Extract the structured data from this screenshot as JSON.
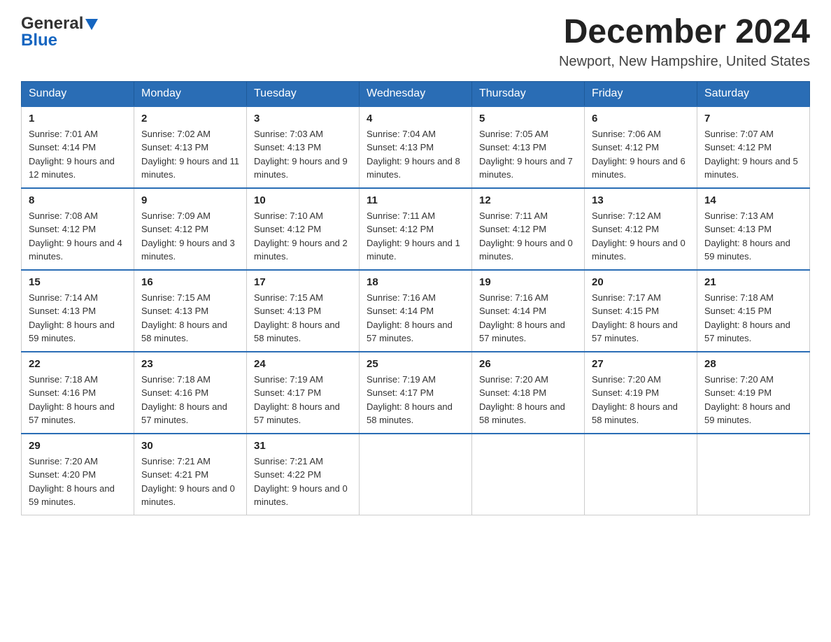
{
  "header": {
    "logo_general": "General",
    "logo_blue": "Blue",
    "month_title": "December 2024",
    "location": "Newport, New Hampshire, United States"
  },
  "weekdays": [
    "Sunday",
    "Monday",
    "Tuesday",
    "Wednesday",
    "Thursday",
    "Friday",
    "Saturday"
  ],
  "weeks": [
    [
      {
        "day": "1",
        "sunrise": "7:01 AM",
        "sunset": "4:14 PM",
        "daylight": "9 hours and 12 minutes."
      },
      {
        "day": "2",
        "sunrise": "7:02 AM",
        "sunset": "4:13 PM",
        "daylight": "9 hours and 11 minutes."
      },
      {
        "day": "3",
        "sunrise": "7:03 AM",
        "sunset": "4:13 PM",
        "daylight": "9 hours and 9 minutes."
      },
      {
        "day": "4",
        "sunrise": "7:04 AM",
        "sunset": "4:13 PM",
        "daylight": "9 hours and 8 minutes."
      },
      {
        "day": "5",
        "sunrise": "7:05 AM",
        "sunset": "4:13 PM",
        "daylight": "9 hours and 7 minutes."
      },
      {
        "day": "6",
        "sunrise": "7:06 AM",
        "sunset": "4:12 PM",
        "daylight": "9 hours and 6 minutes."
      },
      {
        "day": "7",
        "sunrise": "7:07 AM",
        "sunset": "4:12 PM",
        "daylight": "9 hours and 5 minutes."
      }
    ],
    [
      {
        "day": "8",
        "sunrise": "7:08 AM",
        "sunset": "4:12 PM",
        "daylight": "9 hours and 4 minutes."
      },
      {
        "day": "9",
        "sunrise": "7:09 AM",
        "sunset": "4:12 PM",
        "daylight": "9 hours and 3 minutes."
      },
      {
        "day": "10",
        "sunrise": "7:10 AM",
        "sunset": "4:12 PM",
        "daylight": "9 hours and 2 minutes."
      },
      {
        "day": "11",
        "sunrise": "7:11 AM",
        "sunset": "4:12 PM",
        "daylight": "9 hours and 1 minute."
      },
      {
        "day": "12",
        "sunrise": "7:11 AM",
        "sunset": "4:12 PM",
        "daylight": "9 hours and 0 minutes."
      },
      {
        "day": "13",
        "sunrise": "7:12 AM",
        "sunset": "4:12 PM",
        "daylight": "9 hours and 0 minutes."
      },
      {
        "day": "14",
        "sunrise": "7:13 AM",
        "sunset": "4:13 PM",
        "daylight": "8 hours and 59 minutes."
      }
    ],
    [
      {
        "day": "15",
        "sunrise": "7:14 AM",
        "sunset": "4:13 PM",
        "daylight": "8 hours and 59 minutes."
      },
      {
        "day": "16",
        "sunrise": "7:15 AM",
        "sunset": "4:13 PM",
        "daylight": "8 hours and 58 minutes."
      },
      {
        "day": "17",
        "sunrise": "7:15 AM",
        "sunset": "4:13 PM",
        "daylight": "8 hours and 58 minutes."
      },
      {
        "day": "18",
        "sunrise": "7:16 AM",
        "sunset": "4:14 PM",
        "daylight": "8 hours and 57 minutes."
      },
      {
        "day": "19",
        "sunrise": "7:16 AM",
        "sunset": "4:14 PM",
        "daylight": "8 hours and 57 minutes."
      },
      {
        "day": "20",
        "sunrise": "7:17 AM",
        "sunset": "4:15 PM",
        "daylight": "8 hours and 57 minutes."
      },
      {
        "day": "21",
        "sunrise": "7:18 AM",
        "sunset": "4:15 PM",
        "daylight": "8 hours and 57 minutes."
      }
    ],
    [
      {
        "day": "22",
        "sunrise": "7:18 AM",
        "sunset": "4:16 PM",
        "daylight": "8 hours and 57 minutes."
      },
      {
        "day": "23",
        "sunrise": "7:18 AM",
        "sunset": "4:16 PM",
        "daylight": "8 hours and 57 minutes."
      },
      {
        "day": "24",
        "sunrise": "7:19 AM",
        "sunset": "4:17 PM",
        "daylight": "8 hours and 57 minutes."
      },
      {
        "day": "25",
        "sunrise": "7:19 AM",
        "sunset": "4:17 PM",
        "daylight": "8 hours and 58 minutes."
      },
      {
        "day": "26",
        "sunrise": "7:20 AM",
        "sunset": "4:18 PM",
        "daylight": "8 hours and 58 minutes."
      },
      {
        "day": "27",
        "sunrise": "7:20 AM",
        "sunset": "4:19 PM",
        "daylight": "8 hours and 58 minutes."
      },
      {
        "day": "28",
        "sunrise": "7:20 AM",
        "sunset": "4:19 PM",
        "daylight": "8 hours and 59 minutes."
      }
    ],
    [
      {
        "day": "29",
        "sunrise": "7:20 AM",
        "sunset": "4:20 PM",
        "daylight": "8 hours and 59 minutes."
      },
      {
        "day": "30",
        "sunrise": "7:21 AM",
        "sunset": "4:21 PM",
        "daylight": "9 hours and 0 minutes."
      },
      {
        "day": "31",
        "sunrise": "7:21 AM",
        "sunset": "4:22 PM",
        "daylight": "9 hours and 0 minutes."
      },
      null,
      null,
      null,
      null
    ]
  ]
}
